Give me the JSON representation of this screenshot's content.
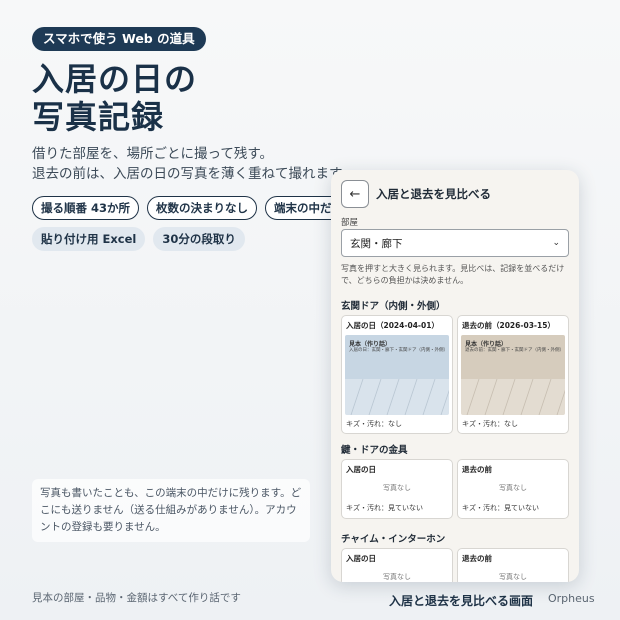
{
  "badge": "スマホで使う Web の道具",
  "headline": {
    "line1": "入居の日の",
    "line2": "写真記録"
  },
  "subtext": {
    "line1": "借りた部屋を、場所ごとに撮って残す。",
    "line2": "退去の前は、入居の日の写真を薄く重ねて撮れます。"
  },
  "tags": [
    "撮る順番 43か所",
    "枚数の決まりなし",
    "端末の中だけ",
    "貼り付け用 Excel",
    "30分の段取り"
  ],
  "note": "写真も書いたことも、この端末の中だけに残ります。どこにも送りません（送る仕組みがありません）。アカウントの登録も要りません。",
  "footnote": "見本の部屋・品物・金額はすべて作り話です",
  "caption": "入居と退去を見比べる画面",
  "brand": "Orpheus",
  "colors": {
    "navy": "#1e3a55",
    "photo_blue": "#c7d6e3",
    "photo_tan": "#d6ccbd"
  },
  "phone": {
    "back_icon": "←",
    "title": "入居と退去を見比べる",
    "room_label": "部屋",
    "room_value": "玄関・廊下",
    "help": "写真を押すと大きく見られます。見比べは、記録を並べるだけで、どちらの負担かは決めません。",
    "sections": [
      {
        "title": "玄関ドア（内側・外側）",
        "move_in": {
          "header": "入居の日（2024-04-01）",
          "photo_title": "見本（作り話）",
          "photo_sub": "入居の日：玄関・廊下・玄関ドア（内側・外側）",
          "damage": "キズ・汚れ：なし"
        },
        "move_out": {
          "header": "退去の前（2026-03-15）",
          "photo_title": "見本（作り話）",
          "photo_sub": "退去の前：玄関・廊下・玄関ドア（内側・外側）",
          "damage": "キズ・汚れ：なし"
        }
      },
      {
        "title": "鍵・ドアの金具",
        "move_in": {
          "header": "入居の日",
          "nophoto": "写真なし",
          "damage": "キズ・汚れ：見ていない"
        },
        "move_out": {
          "header": "退去の前",
          "nophoto": "写真なし",
          "damage": "キズ・汚れ：見ていない"
        }
      },
      {
        "title": "チャイム・インターホン",
        "move_in": {
          "header": "入居の日",
          "nophoto": "写真なし"
        },
        "move_out": {
          "header": "退去の前",
          "nophoto": "写真なし"
        }
      }
    ]
  }
}
